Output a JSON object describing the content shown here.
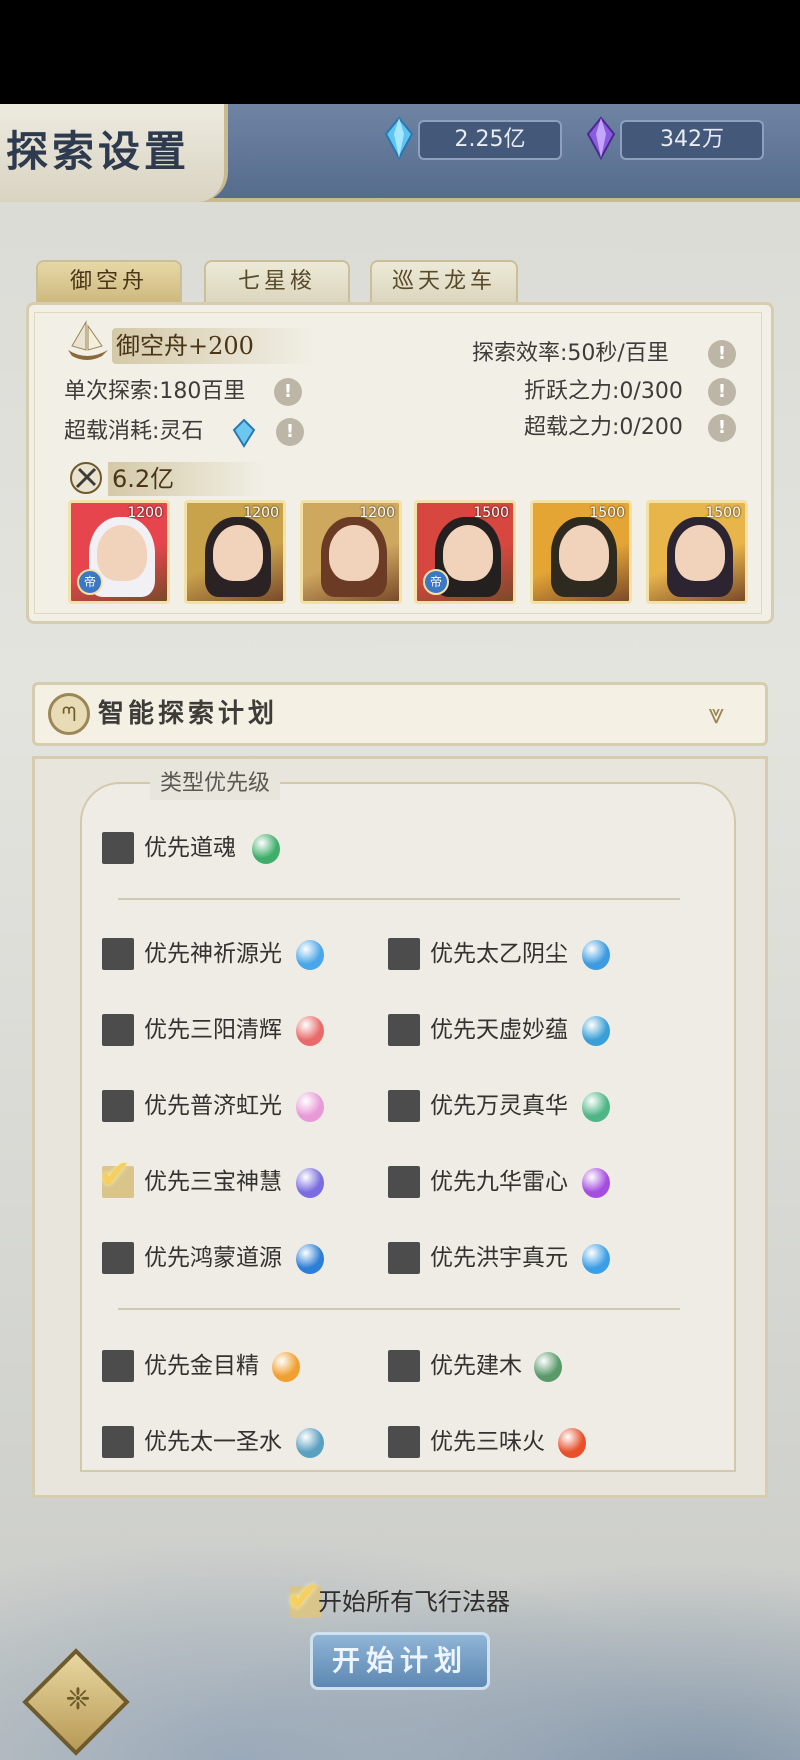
{
  "header": {
    "title": "探索设置"
  },
  "currencies": [
    {
      "icon": "blue-crystal-icon",
      "value": "2.25亿"
    },
    {
      "icon": "purple-crystal-icon",
      "value": "342万"
    }
  ],
  "tabs": [
    {
      "label": "御空舟",
      "active": true
    },
    {
      "label": "七星梭",
      "active": false
    },
    {
      "label": "巡天龙车",
      "active": false
    }
  ],
  "vehicle": {
    "name": "御空舟+200",
    "single_explore": "单次探索:180百里",
    "overload_cost": "超载消耗:灵石",
    "efficiency": "探索效率:50秒/百里",
    "warp_power": "折跃之力:0/300",
    "overload_power": "超载之力:0/200",
    "power": "6.2亿",
    "info_glyph": "!",
    "heroes": [
      {
        "level": "1200",
        "badge": "帝",
        "colors": [
          "#e6454d",
          "#f0f0f5"
        ]
      },
      {
        "level": "1200",
        "badge": "",
        "colors": [
          "#c9a24c",
          "#2b2224"
        ]
      },
      {
        "level": "1200",
        "badge": "",
        "colors": [
          "#cfa860",
          "#6b3b26"
        ]
      },
      {
        "level": "1500",
        "badge": "帝",
        "colors": [
          "#d8473f",
          "#24201f"
        ]
      },
      {
        "level": "1500",
        "badge": "",
        "colors": [
          "#e5a535",
          "#2e2a20"
        ]
      },
      {
        "level": "1500",
        "badge": "",
        "colors": [
          "#e8b54b",
          "#2c2430"
        ]
      }
    ]
  },
  "plan": {
    "title": "智能探索计划",
    "icon_glyph": "ᘉ",
    "toggle_glyph": "⩔",
    "section_label": "类型优先级",
    "options_top": [
      {
        "label": "优先道魂",
        "checked": false,
        "gem_color": "#3fae6a"
      }
    ],
    "options_mid": [
      {
        "label": "优先神祈源光",
        "checked": false,
        "gem_color": "#4aa6e8"
      },
      {
        "label": "优先太乙阴尘",
        "checked": false,
        "gem_color": "#3d9be0"
      },
      {
        "label": "优先三阳清辉",
        "checked": false,
        "gem_color": "#e86a6a"
      },
      {
        "label": "优先天虚妙蕴",
        "checked": false,
        "gem_color": "#3a9fd6"
      },
      {
        "label": "优先普济虹光",
        "checked": false,
        "gem_color": "#e79ad6"
      },
      {
        "label": "优先万灵真华",
        "checked": false,
        "gem_color": "#4fb587"
      },
      {
        "label": "优先三宝神慧",
        "checked": true,
        "gem_color": "#7a6de0"
      },
      {
        "label": "优先九华雷心",
        "checked": false,
        "gem_color": "#a44ee0"
      },
      {
        "label": "优先鸿蒙道源",
        "checked": false,
        "gem_color": "#2c7ed6"
      },
      {
        "label": "优先洪宇真元",
        "checked": false,
        "gem_color": "#3c9fe6"
      }
    ],
    "options_bottom": [
      {
        "label": "优先金目精",
        "checked": false,
        "gem_color": "#f0a030"
      },
      {
        "label": "优先建木",
        "checked": false,
        "gem_color": "#5a9a6a"
      },
      {
        "label": "优先太一圣水",
        "checked": false,
        "gem_color": "#5aa0c0"
      },
      {
        "label": "优先三味火",
        "checked": false,
        "gem_color": "#e8502a"
      }
    ]
  },
  "footer": {
    "start_all_label": "开始所有飞行法器",
    "start_all_checked": true,
    "start_button": "开始计划",
    "checkmark_glyph": "✔",
    "corner_glyph": "❈"
  }
}
